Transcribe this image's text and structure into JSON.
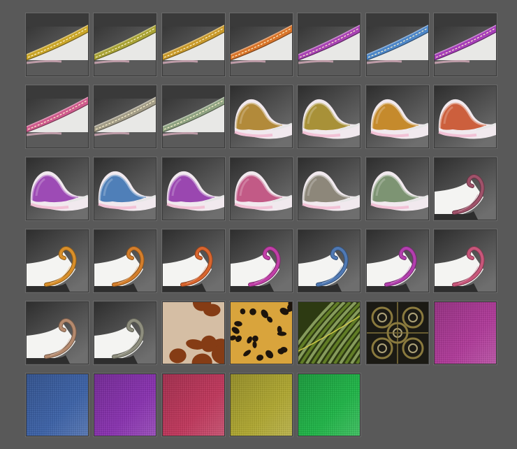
{
  "swatches": [
    {
      "kind": "strap",
      "color": "#c9a529"
    },
    {
      "kind": "strap",
      "color": "#a9a336"
    },
    {
      "kind": "strap",
      "color": "#c99a2c"
    },
    {
      "kind": "strap",
      "color": "#d9752b"
    },
    {
      "kind": "strap",
      "color": "#a843b3"
    },
    {
      "kind": "strap",
      "color": "#4d86c7"
    },
    {
      "kind": "strap",
      "color": "#a63fb8"
    },
    {
      "kind": "strap",
      "color": "#cf5c8e"
    },
    {
      "kind": "strap",
      "color": "#a39d88"
    },
    {
      "kind": "strap",
      "color": "#8fa382"
    },
    {
      "kind": "cup",
      "color": "#b28a3a"
    },
    {
      "kind": "cup",
      "color": "#a89138"
    },
    {
      "kind": "cup",
      "color": "#c58a2c"
    },
    {
      "kind": "cup",
      "color": "#cc5f3d"
    },
    {
      "kind": "cup",
      "color": "#9d4bb5"
    },
    {
      "kind": "cup",
      "color": "#4f7fb8"
    },
    {
      "kind": "cup",
      "color": "#9a47b0"
    },
    {
      "kind": "cup",
      "color": "#c25a86"
    },
    {
      "kind": "cup",
      "color": "#8d877a"
    },
    {
      "kind": "cup",
      "color": "#7d9473"
    },
    {
      "kind": "curl",
      "color": "#a0526a"
    },
    {
      "kind": "curl",
      "color": "#d98f2a"
    },
    {
      "kind": "curl",
      "color": "#d47e2b"
    },
    {
      "kind": "curl",
      "color": "#d9652e"
    },
    {
      "kind": "curl",
      "color": "#c23fa8"
    },
    {
      "kind": "curl",
      "color": "#4f79b4"
    },
    {
      "kind": "curl",
      "color": "#b33fae"
    },
    {
      "kind": "curl",
      "color": "#c8567a"
    },
    {
      "kind": "curl",
      "color": "#b58a6e"
    },
    {
      "kind": "curl",
      "color": "#8e8e7e"
    },
    {
      "kind": "giraffe",
      "color": "#8a3f18"
    },
    {
      "kind": "leopard",
      "color": "#d9a43c"
    },
    {
      "kind": "feather",
      "color": "#6b8a2a"
    },
    {
      "kind": "ornament",
      "color": "#8a7a3e"
    },
    {
      "kind": "fabric",
      "color": "#b03d9a"
    },
    {
      "kind": "fabric",
      "color": "#3f64a8"
    },
    {
      "kind": "fabric",
      "color": "#8a35b0"
    },
    {
      "kind": "fabric",
      "color": "#c03a5e"
    },
    {
      "kind": "fabric",
      "color": "#b0a834"
    },
    {
      "kind": "fabric",
      "color": "#23b54a"
    }
  ]
}
